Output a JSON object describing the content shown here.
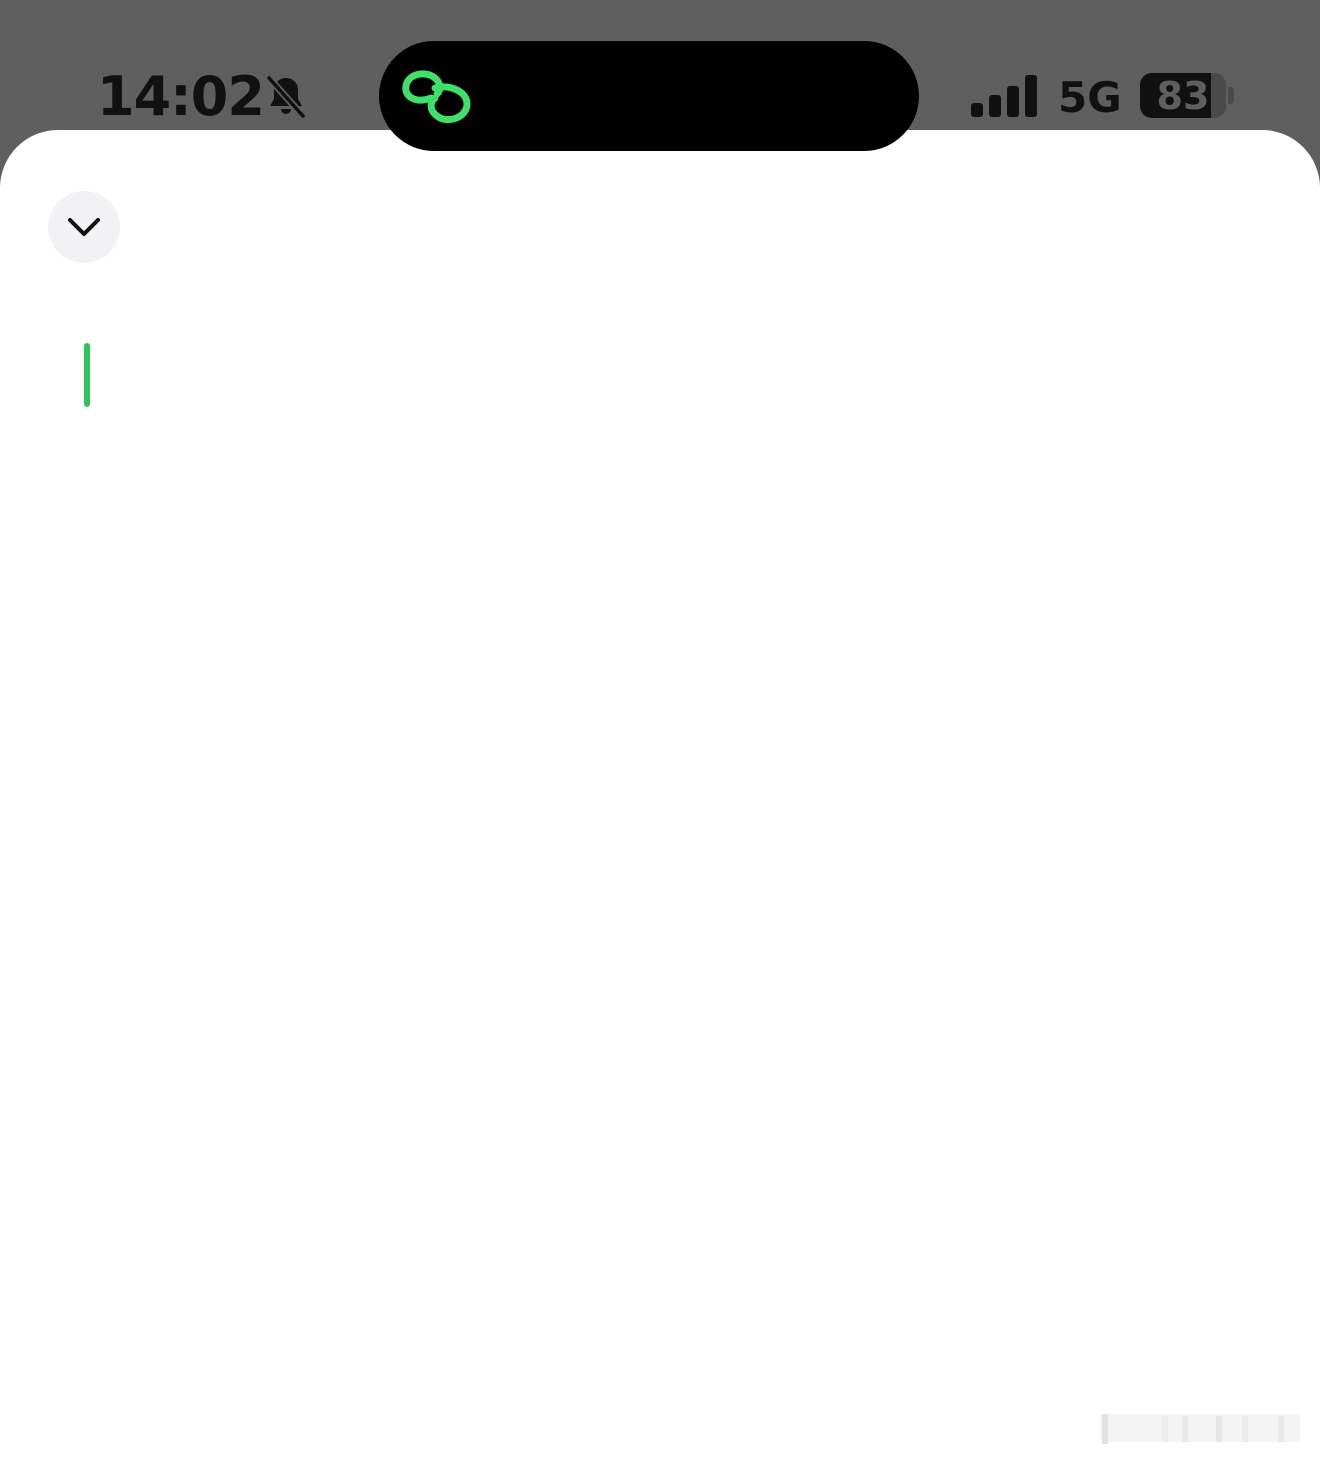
{
  "status_bar": {
    "time": "14:02",
    "silent_icon": "bell-slash-icon",
    "signal_bars": 4,
    "network": "5G",
    "battery_percent": 83
  },
  "dynamic_island": {
    "icon": "link-icon",
    "accent_color": "#3ee06a"
  },
  "sheet": {
    "collapse_icon": "chevron-down-icon",
    "text_input_value": "",
    "caret_color": "#2dc45e"
  }
}
